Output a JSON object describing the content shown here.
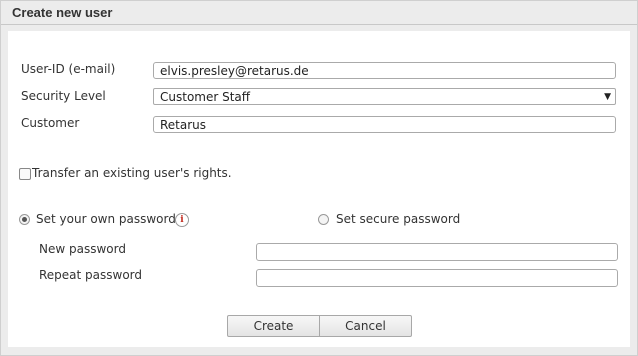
{
  "dialog": {
    "title": "Create new user"
  },
  "form": {
    "user_id": {
      "label": "User-ID (e-mail)",
      "value": "elvis.presley@retarus.de"
    },
    "security_level": {
      "label": "Security Level",
      "value": "Customer Staff",
      "arrow": "▼"
    },
    "customer": {
      "label": "Customer",
      "value": "Retarus"
    },
    "transfer_rights": {
      "label": "Transfer an existing user's rights.",
      "checked": false
    },
    "password_mode": {
      "own": {
        "label": "Set your own password",
        "checked": true
      },
      "secure": {
        "label": "Set secure password",
        "checked": false
      },
      "info_icon": "i"
    },
    "new_password": {
      "label": "New password",
      "value": ""
    },
    "repeat_password": {
      "label": "Repeat password",
      "value": ""
    }
  },
  "buttons": {
    "create": "Create",
    "cancel": "Cancel"
  }
}
